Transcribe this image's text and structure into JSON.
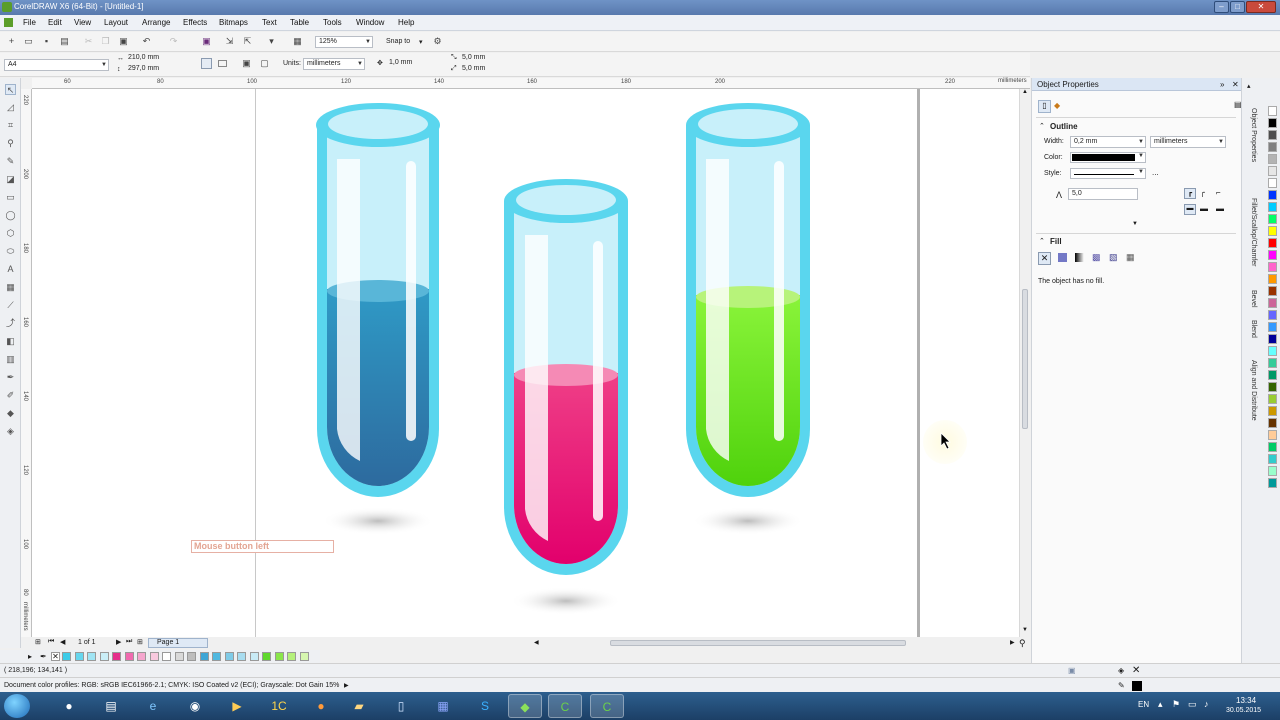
{
  "window": {
    "title": "CorelDRAW X6 (64-Bit) - [Untitled-1]"
  },
  "menu": [
    "File",
    "Edit",
    "View",
    "Layout",
    "Arrange",
    "Effects",
    "Bitmaps",
    "Text",
    "Table",
    "Tools",
    "Window",
    "Help"
  ],
  "toolbar": {
    "zoom": "125%",
    "snap_to": "Snap to"
  },
  "property_bar": {
    "page_size": "A4",
    "width": "210,0 mm",
    "height": "297,0 mm",
    "units_label": "Units:",
    "units": "millimeters",
    "nudge": "1,0 mm",
    "dup_x": "5,0 mm",
    "dup_y": "5,0 mm"
  },
  "ruler": {
    "h_ticks": [
      "60",
      "80",
      "100",
      "120",
      "140",
      "160",
      "180",
      "200",
      "220"
    ],
    "unit": "millimeters",
    "v_ticks": [
      "220",
      "200",
      "180",
      "160",
      "140",
      "120",
      "100",
      "80"
    ],
    "v_unit": "millimeters"
  },
  "page_nav": {
    "count": "1 of 1",
    "page_tab": "Page 1"
  },
  "canvas": {
    "mouse_label": "Mouse button left"
  },
  "status": {
    "coords": "( 218,196; 134,141 )",
    "color_profiles": "Document color profiles: RGB: sRGB IEC61966-2.1; CMYK: ISO Coated v2 (ECI); Grayscale: Dot Gain 15%"
  },
  "docker": {
    "title": "Object Properties",
    "outline": {
      "heading": "Outline",
      "width_label": "Width:",
      "width_value": "0,2 mm",
      "width_units": "millimeters",
      "color_label": "Color:",
      "style_label": "Style:",
      "style_more": "...",
      "miter_value": "5,0"
    },
    "fill": {
      "heading": "Fill",
      "message": "The object has no fill."
    }
  },
  "docker_tabs": [
    "Object Properties",
    "Fillet/Scallop/Chamfer",
    "Bevel",
    "Blend",
    "Align and Distribute"
  ],
  "taskbar": {
    "lang": "EN",
    "time": "13:34",
    "date": "30.05.2015"
  },
  "colors": {
    "tube_glass": "#c8f0fa",
    "tube_rim": "#5ad6ee",
    "liquid_blue": "#2f8fbd",
    "liquid_pink": "#e8106f",
    "liquid_green": "#6fe81a",
    "accent": "#5879ad"
  },
  "palette_bottom": [
    "#3ccbe8",
    "#66d6ee",
    "#9fe4f4",
    "#c9eef8",
    "#e52e8a",
    "#f06ab0",
    "#f5a6cf",
    "#f8c9df",
    "#ffffff",
    "#d9d9d9",
    "#bdbdbd",
    "#3ca5d6",
    "#4fb8e0",
    "#7fcbe8",
    "#a7dcf0",
    "#c7eaf6",
    "#5fd82e",
    "#8ae64c",
    "#b4f07c",
    "#d6f7b0"
  ],
  "palette_right": [
    "#ffffff",
    "#000000",
    "#4d4d4d",
    "#808080",
    "#b3b3b3",
    "#e6e6e6",
    "#ffffff",
    "#0033ff",
    "#00ccff",
    "#00ff66",
    "#ffff00",
    "#ff0000",
    "#ff00ff",
    "#ff66cc",
    "#ff9900",
    "#993300",
    "#cc6699",
    "#6666ff",
    "#3399ff",
    "#000099",
    "#66ffff",
    "#33cc99",
    "#009966",
    "#336600",
    "#99cc33",
    "#cc9900",
    "#663300",
    "#ffcc99",
    "#00cc66",
    "#33cccc",
    "#99ffcc",
    "#009999"
  ]
}
